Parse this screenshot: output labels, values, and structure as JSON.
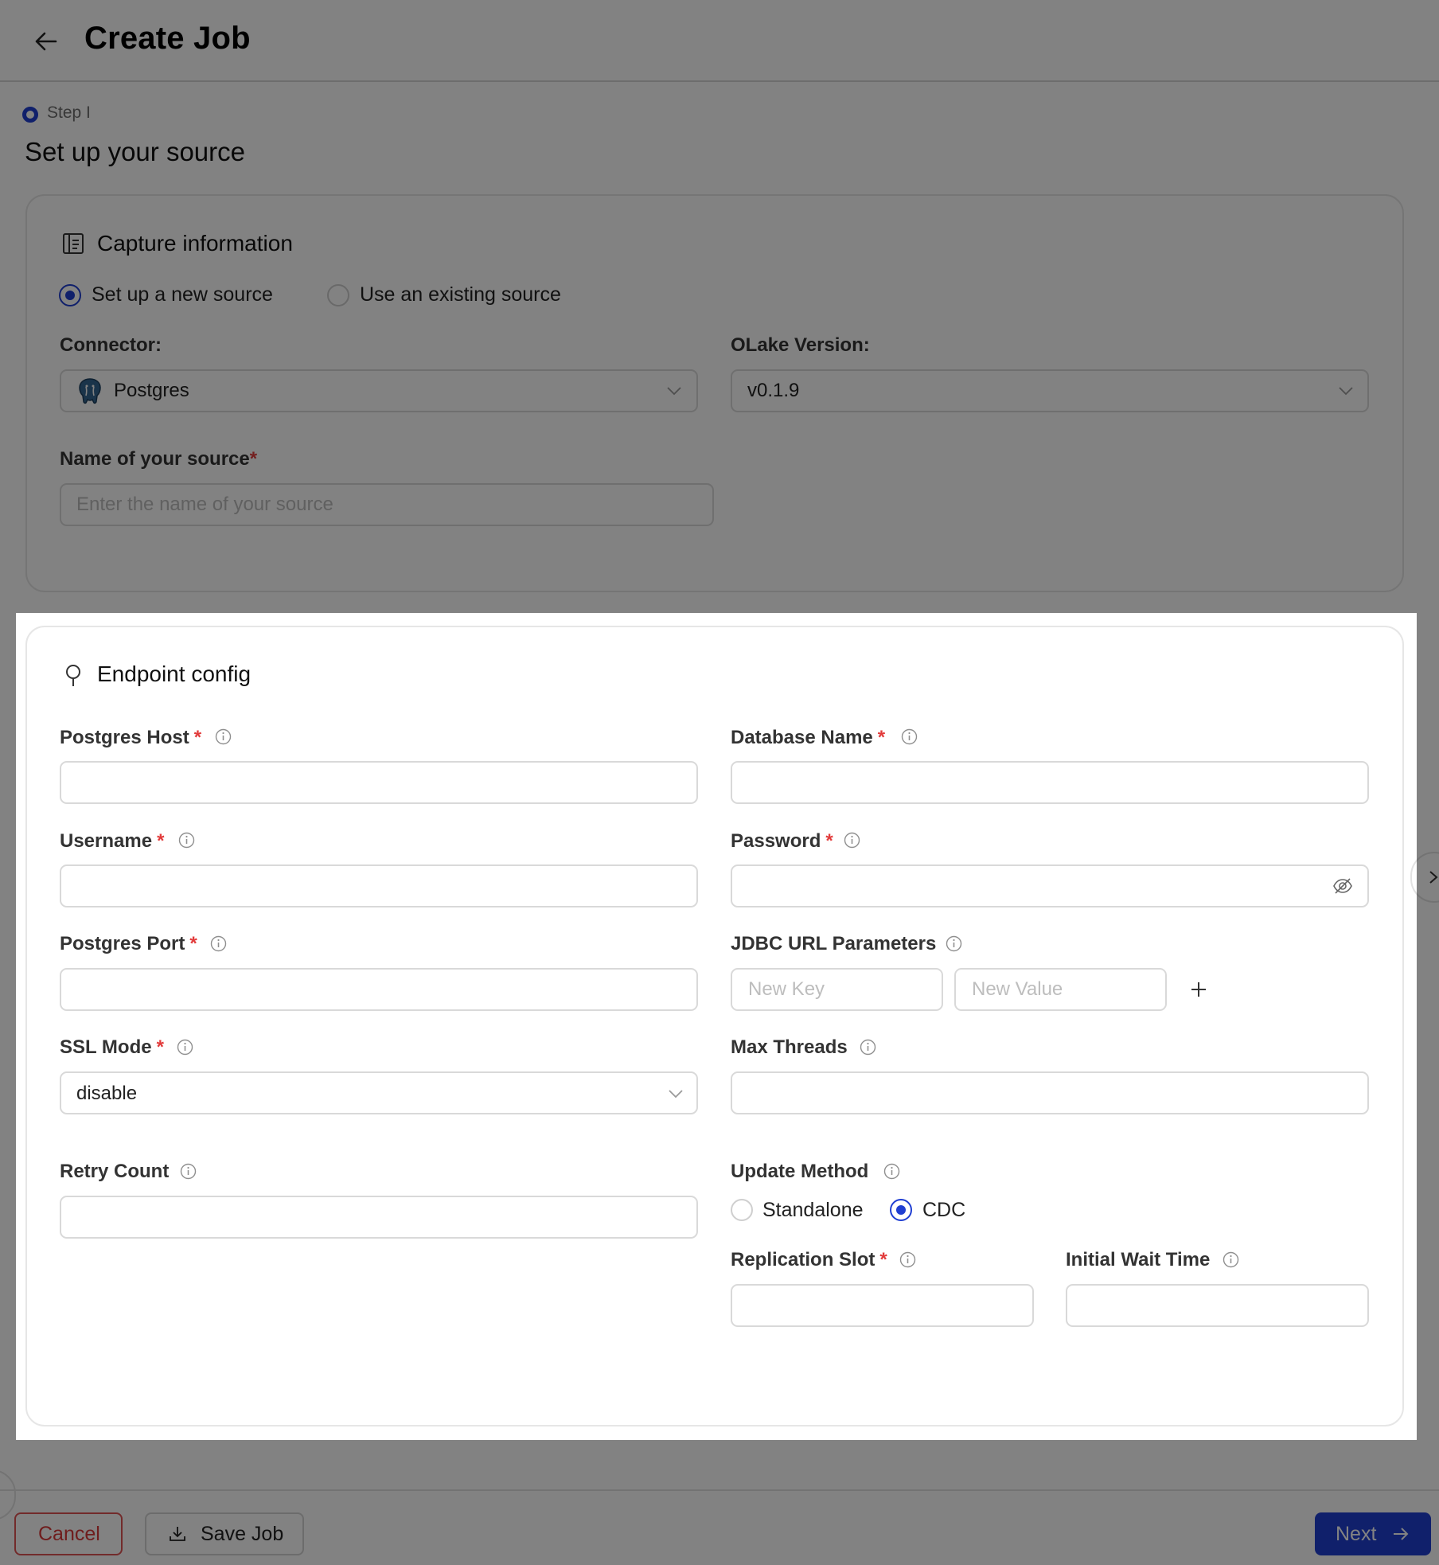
{
  "header": {
    "title": "Create Job"
  },
  "step": {
    "label": "Step I",
    "title": "Set up your source"
  },
  "capture": {
    "title": "Capture information",
    "options": [
      {
        "label": "Set up a new source",
        "selected": true
      },
      {
        "label": "Use an existing source",
        "selected": false
      }
    ],
    "connector": {
      "label": "Connector:",
      "value": "Postgres"
    },
    "version": {
      "label": "OLake Version:",
      "value": "v0.1.9"
    },
    "source_name": {
      "label": "Name of your source",
      "required_mark": "*",
      "placeholder": "Enter the name of your source"
    }
  },
  "endpoint": {
    "title": "Endpoint config",
    "postgres_host": {
      "label": "Postgres Host",
      "required_mark": "*"
    },
    "database_name": {
      "label": "Database Name",
      "required_mark": "*"
    },
    "username": {
      "label": "Username",
      "required_mark": "*"
    },
    "password": {
      "label": "Password",
      "required_mark": "*"
    },
    "postgres_port": {
      "label": "Postgres Port",
      "required_mark": "*"
    },
    "jdbc": {
      "label": "JDBC URL Parameters",
      "key_placeholder": "New Key",
      "value_placeholder": "New Value"
    },
    "ssl_mode": {
      "label": "SSL Mode",
      "required_mark": "*",
      "value": "disable"
    },
    "max_threads": {
      "label": "Max Threads"
    },
    "retry_count": {
      "label": "Retry Count"
    },
    "update_method": {
      "label": "Update Method",
      "options": [
        {
          "label": "Standalone",
          "selected": false
        },
        {
          "label": "CDC",
          "selected": true
        }
      ]
    },
    "replication_slot": {
      "label": "Replication Slot",
      "required_mark": "*"
    },
    "initial_wait_time": {
      "label": "Initial Wait Time"
    }
  },
  "footer": {
    "cancel": "Cancel",
    "save": "Save Job",
    "next": "Next"
  },
  "colors": {
    "primary": "#203fd2",
    "required": "#e23b3b",
    "cancel": "#d93a3a",
    "overlay": "rgba(0,0,0,0.49)"
  }
}
